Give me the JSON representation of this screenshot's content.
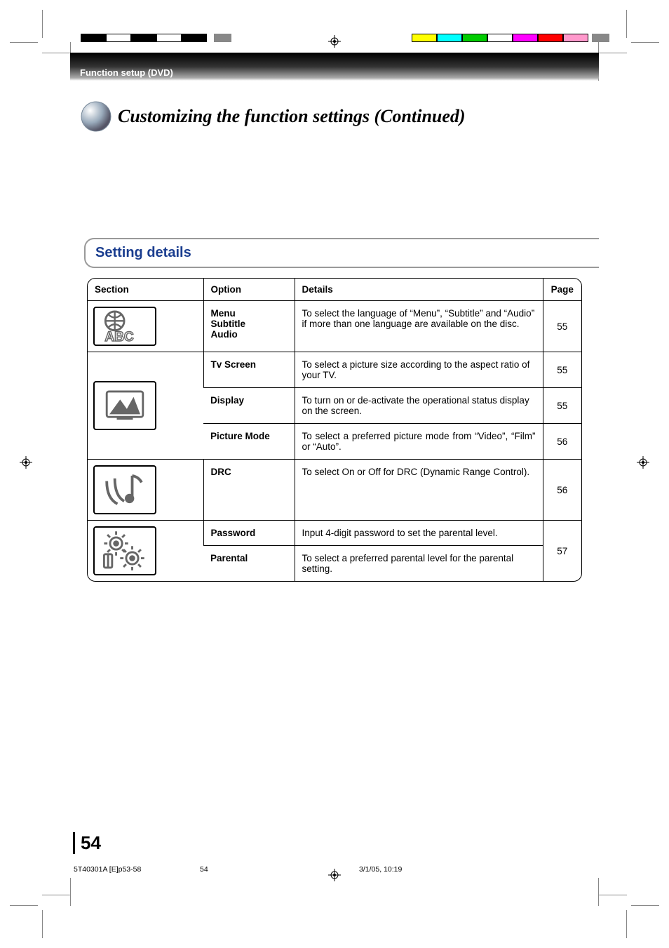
{
  "header": {
    "breadcrumb": "Function setup (DVD)",
    "title": "Customizing the function settings (Continued)"
  },
  "subheader": "Setting details",
  "table": {
    "headers": {
      "section": "Section",
      "option": "Option",
      "details": "Details",
      "page": "Page"
    },
    "rows": [
      {
        "section_icon": "globe-abc-icon",
        "option_multi": [
          "Menu",
          "Subtitle",
          "Audio"
        ],
        "details": "To select the language of “Menu”, “Subtitle” and “Audio” if more than one language are available on the disc.",
        "page": "55",
        "rowspan_section": 1,
        "rowspan_page": 1
      },
      {
        "section_icon": "monitor-mountain-icon",
        "option": "Tv Screen",
        "details": "To select a picture size according to the aspect ratio of your TV.",
        "page": "55",
        "rowspan_section": 3,
        "rowspan_page": 1
      },
      {
        "option": "Display",
        "details": "To turn on or de-activate the operational status display on the screen.",
        "page": "55",
        "rowspan_page": 1
      },
      {
        "option": "Picture Mode",
        "details": "To select a preferred picture mode from “Video”, “Film” or “Auto”.",
        "page": "56",
        "rowspan_page": 1
      },
      {
        "section_icon": "speaker-note-icon",
        "option": "DRC",
        "details": "To select On or Off for DRC (Dynamic Range Control).",
        "page": "56",
        "rowspan_section": 1,
        "rowspan_page": 1
      },
      {
        "section_icon": "gears-icon",
        "option": "Password",
        "details": "Input 4-digit password to set the parental level.",
        "page": "57",
        "rowspan_section": 2,
        "rowspan_page": 2
      },
      {
        "option": "Parental",
        "details": "To select a preferred parental level for the parental setting."
      }
    ]
  },
  "page_number": "54",
  "footer": {
    "filename": "5T40301A [E]p53-58",
    "page_printed": "54",
    "date": "3/1/05, 10:19"
  }
}
